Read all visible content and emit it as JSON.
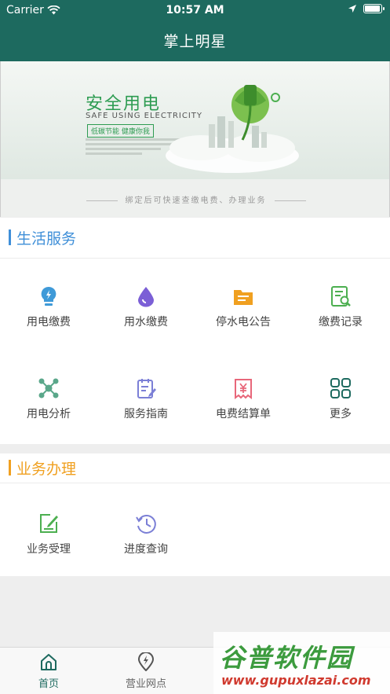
{
  "status_bar": {
    "carrier": "Carrier",
    "time": "10:57 AM"
  },
  "header": {
    "title": "掌上明星"
  },
  "banner": {
    "title": "安全用电",
    "subtitle": "SAFE USING ELECTRICITY",
    "slogan": "低碳节能  健康你我",
    "caption": "绑定后可快速查缴电费、办理业务"
  },
  "life_services": {
    "title": "生活服务",
    "accent": "#3f8fd8",
    "items": [
      {
        "label": "用电缴费",
        "icon": "bulb-icon",
        "color": "#3f9ad8"
      },
      {
        "label": "用水缴费",
        "icon": "water-drop-icon",
        "color": "#7b5fd6"
      },
      {
        "label": "停水电公告",
        "icon": "notice-folder-icon",
        "color": "#f0a020"
      },
      {
        "label": "缴费记录",
        "icon": "record-search-icon",
        "color": "#4caf50"
      },
      {
        "label": "用电分析",
        "icon": "network-nodes-icon",
        "color": "#5aa78a"
      },
      {
        "label": "服务指南",
        "icon": "guide-notebook-icon",
        "color": "#7b7fd6"
      },
      {
        "label": "电费结算单",
        "icon": "yuan-bill-icon",
        "color": "#e8677a"
      },
      {
        "label": "更多",
        "icon": "grid-more-icon",
        "color": "#1d6a5f"
      }
    ]
  },
  "business": {
    "title": "业务办理",
    "accent": "#f0a020",
    "items": [
      {
        "label": "业务受理",
        "icon": "edit-form-icon",
        "color": "#4caf50"
      },
      {
        "label": "进度查询",
        "icon": "history-clock-icon",
        "color": "#7b7fd6"
      }
    ]
  },
  "tabbar": {
    "items": [
      {
        "label": "首页",
        "icon": "home-icon"
      },
      {
        "label": "营业网点",
        "icon": "location-pin-icon"
      }
    ]
  },
  "watermark": {
    "text": "谷普软件园",
    "url": "www.gupuxlazai.com"
  }
}
